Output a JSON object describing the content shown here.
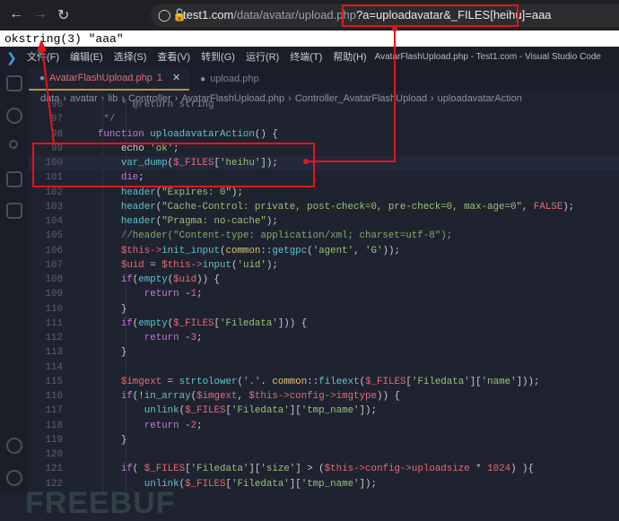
{
  "browser": {
    "back_icon": "arrow-left",
    "forward_icon": "arrow-right",
    "reload_icon": "reload",
    "url_host": "test1.com",
    "url_path": "/data/avatar/upload.php",
    "url_query": "?a=uploadavatar&_FILES[heihu]=aaa"
  },
  "page_output": "okstring(3) \"aaa\"",
  "vscode": {
    "menu": [
      "文件(F)",
      "编辑(E)",
      "选择(S)",
      "查看(V)",
      "转到(G)",
      "运行(R)",
      "终端(T)",
      "帮助(H)"
    ],
    "window_title": "AvatarFlashUpload.php - Test1.com - Visual Studio Code",
    "tabs": [
      {
        "label": "AvatarFlashUpload.php",
        "badge": "1",
        "active": true
      },
      {
        "label": "upload.php",
        "active": false
      }
    ],
    "breadcrumb": [
      "data",
      "avatar",
      "lib",
      "Controller",
      "AvatarFlashUpload.php",
      "Controller_AvatarFlashUpload",
      "uploadavatarAction"
    ],
    "watermark": "FREEBUF",
    "annotation_color": "#e8141b",
    "code": [
      {
        "n": "96",
        "t": [
          [
            "c",
            "        * @return string"
          ]
        ]
      },
      {
        "n": "97",
        "t": [
          [
            "c",
            "     */"
          ]
        ]
      },
      {
        "n": "98",
        "t": [
          [
            "k",
            "    function "
          ],
          [
            "f",
            "uploadavatarAction"
          ],
          [
            "p",
            "() {"
          ]
        ]
      },
      {
        "n": "99",
        "t": [
          [
            "p",
            "        echo "
          ],
          [
            "s",
            "'ok'"
          ],
          [
            "p",
            ";"
          ]
        ]
      },
      {
        "n": "100",
        "cur": true,
        "t": [
          [
            "f",
            "        var_dump"
          ],
          [
            "p",
            "("
          ],
          [
            "v",
            "$_FILES"
          ],
          [
            "p",
            "["
          ],
          [
            "s",
            "'heihu'"
          ],
          [
            "p",
            "]);"
          ]
        ]
      },
      {
        "n": "101",
        "t": [
          [
            "k",
            "        die"
          ],
          [
            "p",
            ";"
          ]
        ]
      },
      {
        "n": "102",
        "t": [
          [
            "f",
            "        header"
          ],
          [
            "p",
            "("
          ],
          [
            "s",
            "\"Expires: 0\""
          ],
          [
            "p",
            ");"
          ]
        ]
      },
      {
        "n": "103",
        "t": [
          [
            "f",
            "        header"
          ],
          [
            "p",
            "("
          ],
          [
            "s",
            "\"Cache-Control: private, post-check=0, pre-check=0, max-age=0\""
          ],
          [
            "p",
            ", "
          ],
          [
            "n",
            "FALSE"
          ],
          [
            "p",
            ");"
          ]
        ]
      },
      {
        "n": "104",
        "t": [
          [
            "f",
            "        header"
          ],
          [
            "p",
            "("
          ],
          [
            "s",
            "\"Pragma: no-cache\""
          ],
          [
            "p",
            ");"
          ]
        ]
      },
      {
        "n": "105",
        "t": [
          [
            "c",
            "        //"
          ],
          [
            "cg",
            "header(\"Content-type: application/xml; charset=utf-8\");"
          ]
        ]
      },
      {
        "n": "106",
        "t": [
          [
            "v",
            "        $this"
          ],
          [
            "o",
            "->"
          ],
          [
            "f",
            "init_input"
          ],
          [
            "p",
            "("
          ],
          [
            "y",
            "common"
          ],
          [
            "p",
            "::"
          ],
          [
            "f",
            "getgpc"
          ],
          [
            "p",
            "("
          ],
          [
            "s",
            "'agent'"
          ],
          [
            "p",
            ", "
          ],
          [
            "s",
            "'G'"
          ],
          [
            "p",
            "));"
          ]
        ]
      },
      {
        "n": "107",
        "t": [
          [
            "v",
            "        $uid"
          ],
          [
            "p",
            " = "
          ],
          [
            "v",
            "$this"
          ],
          [
            "o",
            "->"
          ],
          [
            "f",
            "input"
          ],
          [
            "p",
            "("
          ],
          [
            "s",
            "'uid'"
          ],
          [
            "p",
            ");"
          ]
        ]
      },
      {
        "n": "108",
        "t": [
          [
            "k",
            "        if"
          ],
          [
            "p",
            "("
          ],
          [
            "f",
            "empty"
          ],
          [
            "p",
            "("
          ],
          [
            "v",
            "$uid"
          ],
          [
            "p",
            ")) {"
          ]
        ]
      },
      {
        "n": "109",
        "t": [
          [
            "k",
            "            return "
          ],
          [
            "p",
            "-"
          ],
          [
            "n",
            "1"
          ],
          [
            "p",
            ";"
          ]
        ]
      },
      {
        "n": "110",
        "t": [
          [
            "p",
            "        }"
          ]
        ]
      },
      {
        "n": "111",
        "t": [
          [
            "k",
            "        if"
          ],
          [
            "p",
            "("
          ],
          [
            "f",
            "empty"
          ],
          [
            "p",
            "("
          ],
          [
            "v",
            "$_FILES"
          ],
          [
            "p",
            "["
          ],
          [
            "s",
            "'Filedata'"
          ],
          [
            "p",
            "])) {"
          ]
        ]
      },
      {
        "n": "112",
        "t": [
          [
            "k",
            "            return "
          ],
          [
            "p",
            "-"
          ],
          [
            "n",
            "3"
          ],
          [
            "p",
            ";"
          ]
        ]
      },
      {
        "n": "113",
        "t": [
          [
            "p",
            "        }"
          ]
        ]
      },
      {
        "n": "114",
        "t": []
      },
      {
        "n": "115",
        "t": [
          [
            "v",
            "        $imgext"
          ],
          [
            "p",
            " = "
          ],
          [
            "f",
            "strtolower"
          ],
          [
            "p",
            "("
          ],
          [
            "s",
            "'.'"
          ],
          [
            "p",
            ". "
          ],
          [
            "y",
            "common"
          ],
          [
            "p",
            "::"
          ],
          [
            "f",
            "fileext"
          ],
          [
            "p",
            "("
          ],
          [
            "v",
            "$_FILES"
          ],
          [
            "p",
            "["
          ],
          [
            "s",
            "'Filedata'"
          ],
          [
            "p",
            "]["
          ],
          [
            "s",
            "'name'"
          ],
          [
            "p",
            "]));"
          ]
        ]
      },
      {
        "n": "116",
        "t": [
          [
            "k",
            "        if"
          ],
          [
            "p",
            "(!"
          ],
          [
            "f",
            "in_array"
          ],
          [
            "p",
            "("
          ],
          [
            "v",
            "$imgext"
          ],
          [
            "p",
            ", "
          ],
          [
            "v",
            "$this"
          ],
          [
            "o",
            "->"
          ],
          [
            "v",
            "config"
          ],
          [
            "o",
            "->"
          ],
          [
            "v",
            "imgtype"
          ],
          [
            "p",
            ")) {"
          ]
        ]
      },
      {
        "n": "117",
        "t": [
          [
            "f",
            "            unlink"
          ],
          [
            "p",
            "("
          ],
          [
            "v",
            "$_FILES"
          ],
          [
            "p",
            "["
          ],
          [
            "s",
            "'Filedata'"
          ],
          [
            "p",
            "]["
          ],
          [
            "s",
            "'tmp_name'"
          ],
          [
            "p",
            "]);"
          ]
        ]
      },
      {
        "n": "118",
        "t": [
          [
            "k",
            "            return "
          ],
          [
            "p",
            "-"
          ],
          [
            "n",
            "2"
          ],
          [
            "p",
            ";"
          ]
        ]
      },
      {
        "n": "119",
        "t": [
          [
            "p",
            "        }"
          ]
        ]
      },
      {
        "n": "120",
        "t": []
      },
      {
        "n": "121",
        "t": [
          [
            "k",
            "        if"
          ],
          [
            "p",
            "( "
          ],
          [
            "v",
            "$_FILES"
          ],
          [
            "p",
            "["
          ],
          [
            "s",
            "'Filedata'"
          ],
          [
            "p",
            "]["
          ],
          [
            "s",
            "'size'"
          ],
          [
            "p",
            "] > ("
          ],
          [
            "v",
            "$this"
          ],
          [
            "o",
            "->"
          ],
          [
            "v",
            "config"
          ],
          [
            "o",
            "->"
          ],
          [
            "v",
            "uploadsize"
          ],
          [
            "p",
            " * "
          ],
          [
            "n",
            "1024"
          ],
          [
            "p",
            ") ){"
          ]
        ]
      },
      {
        "n": "122",
        "t": [
          [
            "f",
            "            unlink"
          ],
          [
            "p",
            "("
          ],
          [
            "v",
            "$_FILES"
          ],
          [
            "p",
            "["
          ],
          [
            "s",
            "'Filedata'"
          ],
          [
            "p",
            "]["
          ],
          [
            "s",
            "'tmp_name'"
          ],
          [
            "p",
            "]);"
          ]
        ]
      }
    ]
  }
}
